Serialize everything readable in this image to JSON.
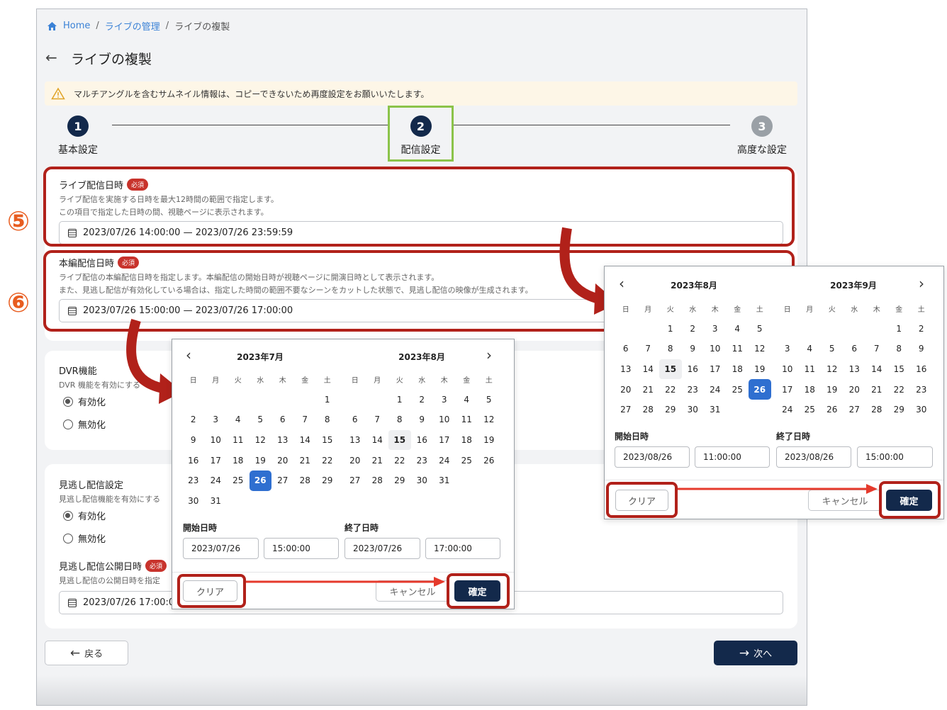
{
  "breadcrumb": {
    "home": "Home",
    "sep1": "/",
    "manage": "ライブの管理",
    "sep2": "/",
    "current": "ライブの複製"
  },
  "page_title": "ライブの複製",
  "warning": "マルチアングルを含むサムネイル情報は、コピーできないため再度設定をお願いいたします。",
  "steps": [
    {
      "num": "1",
      "label": "基本設定"
    },
    {
      "num": "2",
      "label": "配信設定"
    },
    {
      "num": "3",
      "label": "高度な設定"
    }
  ],
  "live_datetime": {
    "label": "ライブ配信日時",
    "required": "必須",
    "help1": "ライブ配信を実施する日時を最大12時間の範囲で指定します。",
    "help2": "この項目で指定した日時の間、視聴ページに表示されます。",
    "value": "2023/07/26 14:00:00 — 2023/07/26 23:59:59"
  },
  "main_datetime": {
    "label": "本編配信日時",
    "required": "必須",
    "help1": "ライブ配信の本編配信日時を指定します。本編配信の開始日時が視聴ページに開演日時として表示されます。",
    "help2": "また、見逃し配信が有効化している場合は、指定した時間の範囲不要なシーンをカットした状態で、見逃し配信の映像が生成されます。",
    "value": "2023/07/26 15:00:00 — 2023/07/26 17:00:00"
  },
  "dvr": {
    "label": "DVR機能",
    "help": "DVR 機能を有効にする",
    "opt_on": "有効化",
    "opt_off": "無効化"
  },
  "missed": {
    "label": "見逃し配信設定",
    "help": "見逃し配信機能を有効にする",
    "opt_on": "有効化",
    "opt_off": "無効化",
    "pub_label": "見逃し配信公開日時",
    "pub_required": "必須",
    "pub_help": "見逃し配信の公開日時を指定",
    "pub_value": "2023/07/26 17:00:0"
  },
  "footer": {
    "back": "戻る",
    "next": "次へ"
  },
  "annotations": {
    "n5": "⑤",
    "n6": "⑥"
  },
  "weekdays": [
    "日",
    "月",
    "火",
    "水",
    "木",
    "金",
    "土"
  ],
  "popup1": {
    "left_title": "2023年7月",
    "right_title": "2023年8月",
    "left_days": [
      "",
      "",
      "",
      "",
      "",
      "",
      "1",
      "2",
      "3",
      "4",
      "5",
      "6",
      "7",
      "8",
      "9",
      "10",
      "11",
      "12",
      "13",
      "14",
      "15",
      "16",
      "17",
      "18",
      "19",
      "20",
      "21",
      "22",
      "23",
      "24",
      "25",
      "26",
      "27",
      "28",
      "29",
      "30",
      "31"
    ],
    "right_days": [
      "",
      "",
      "1",
      "2",
      "3",
      "4",
      "5",
      "6",
      "7",
      "8",
      "9",
      "10",
      "11",
      "12",
      "13",
      "14",
      "15",
      "16",
      "17",
      "18",
      "19",
      "20",
      "21",
      "22",
      "23",
      "24",
      "25",
      "26",
      "27",
      "28",
      "29",
      "30",
      "31"
    ],
    "left_selected": "26",
    "right_today": "15",
    "start_label": "開始日時",
    "end_label": "終了日時",
    "start_date": "2023/07/26",
    "start_time": "15:00:00",
    "end_date": "2023/07/26",
    "end_time": "17:00:00",
    "clear": "クリア",
    "cancel": "キャンセル",
    "confirm": "確定"
  },
  "popup2": {
    "left_title": "2023年8月",
    "right_title": "2023年9月",
    "left_days": [
      "",
      "",
      "1",
      "2",
      "3",
      "4",
      "5",
      "6",
      "7",
      "8",
      "9",
      "10",
      "11",
      "12",
      "13",
      "14",
      "15",
      "16",
      "17",
      "18",
      "19",
      "20",
      "21",
      "22",
      "23",
      "24",
      "25",
      "26",
      "27",
      "28",
      "29",
      "30",
      "31"
    ],
    "right_days": [
      "",
      "",
      "",
      "",
      "",
      "1",
      "2",
      "3",
      "4",
      "5",
      "6",
      "7",
      "8",
      "9",
      "10",
      "11",
      "12",
      "13",
      "14",
      "15",
      "16",
      "17",
      "18",
      "19",
      "20",
      "21",
      "22",
      "23",
      "24",
      "25",
      "26",
      "27",
      "28",
      "29",
      "30"
    ],
    "left_selected": "26",
    "left_today": "15",
    "start_label": "開始日時",
    "end_label": "終了日時",
    "start_date": "2023/08/26",
    "start_time": "11:00:00",
    "end_date": "2023/08/26",
    "end_time": "15:00:00",
    "clear": "クリア",
    "cancel": "キャンセル",
    "confirm": "確定"
  },
  "colors": {
    "primary": "#13294b",
    "accent": "#2f6fd0",
    "annotation_red": "#b1211a",
    "step_highlight": "#8bc34a",
    "warning_bg": "#fdf6e7"
  }
}
